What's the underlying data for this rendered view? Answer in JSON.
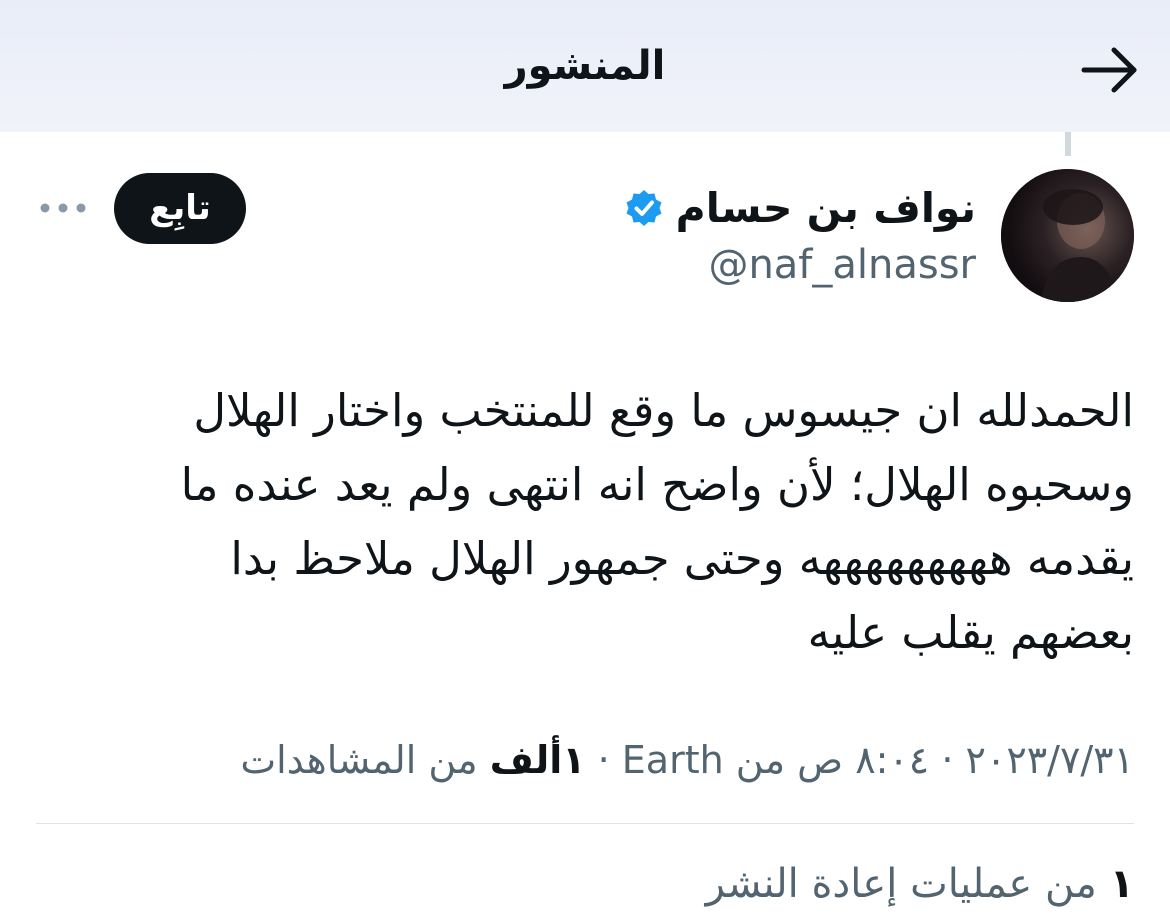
{
  "header": {
    "title": "المنشور",
    "back_icon": "arrow-right-icon"
  },
  "author": {
    "display_name": "نواف بن حسام",
    "handle": "@naf_alnassr",
    "verified_icon": "verified-badge-icon",
    "verified_color": "#1d9bf0",
    "avatar_icon": "avatar-photo"
  },
  "actions": {
    "follow_label": "تابِع",
    "more_icon": "more-options-icon"
  },
  "tweet": {
    "lines": [
      "الحمدلله ان جيسوس ما وقع للمنتخب واختار الهلال",
      "وسحبوه الهلال؛ لأن واضح انه انتهى ولم يعد عنده ما",
      "يقدمه هههههههههه وحتى جمهور الهلال ملاحظ بدا",
      "بعضهم يقلب عليه"
    ]
  },
  "meta": {
    "date": "٢٠٢٣/٧/٣١",
    "time": "٨:٠٤ ص",
    "location_prefix": "من",
    "location": "Earth",
    "separator": "·",
    "views_count": "١ألف",
    "views_label": "من المشاهدات"
  },
  "retweets": {
    "count": "١",
    "label": "من عمليات إعادة النشر"
  },
  "colors": {
    "text_primary": "#0f1419",
    "text_secondary": "#536471",
    "header_bg": "#eceff8",
    "follow_bg": "#0f1419",
    "divider": "#dfe4e8"
  }
}
